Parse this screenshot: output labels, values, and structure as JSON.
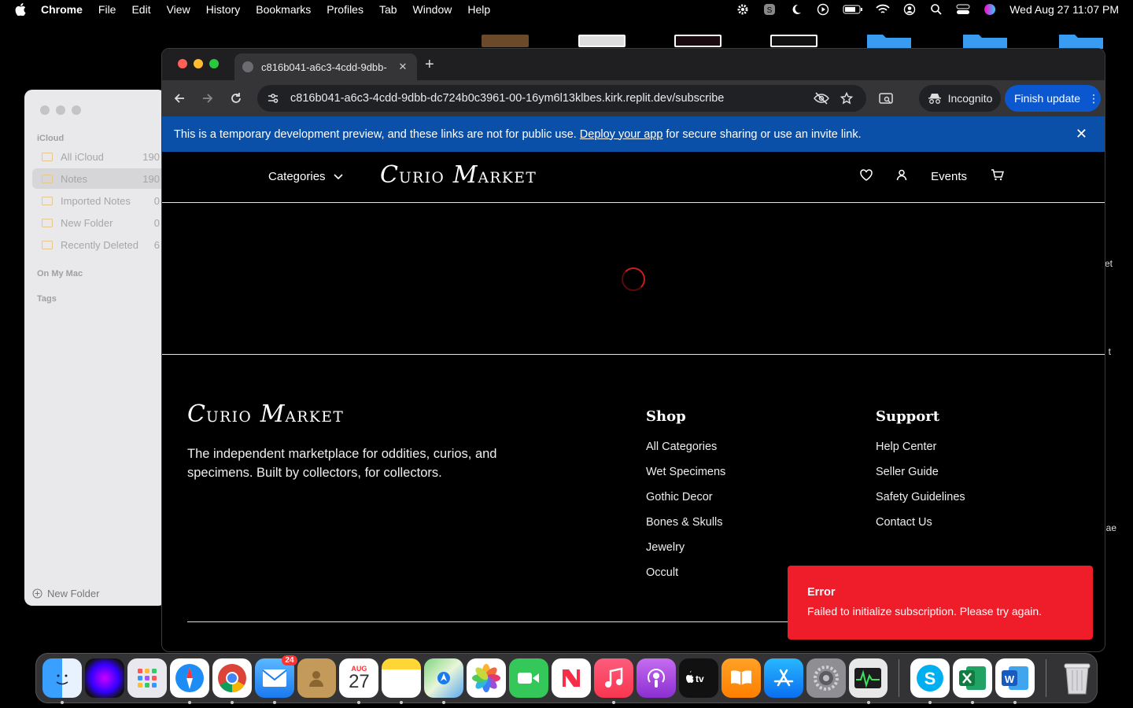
{
  "menubar": {
    "app_name": "Chrome",
    "items": [
      "File",
      "Edit",
      "View",
      "History",
      "Bookmarks",
      "Profiles",
      "Tab",
      "Window",
      "Help"
    ],
    "clock": "Wed Aug 27  11:07 PM"
  },
  "desktop_labels": [
    "et",
    "t",
    "ae"
  ],
  "notes": {
    "section_icloud": "iCloud",
    "folders": [
      {
        "label": "All iCloud",
        "count": "190"
      },
      {
        "label": "Notes",
        "count": "190"
      },
      {
        "label": "Imported Notes",
        "count": "0"
      },
      {
        "label": "New Folder",
        "count": "0"
      },
      {
        "label": "Recently Deleted",
        "count": "6"
      }
    ],
    "section_on_my_mac": "On My Mac",
    "section_tags": "Tags",
    "new_folder": "New Folder"
  },
  "chrome": {
    "tab_title": "c816b041-a6c3-4cdd-9dbb-",
    "url": "c816b041-a6c3-4cdd-9dbb-dc724b0c3961-00-16ym6l13klbes.kirk.replit.dev/subscribe",
    "incognito_label": "Incognito",
    "finish_update_label": "Finish update"
  },
  "banner": {
    "text_before": "This is a temporary development preview, and these links are not for public use.",
    "link_text": "Deploy your app",
    "text_after": "for secure sharing or use an invite link."
  },
  "site": {
    "categories_label": "Categories",
    "logo_c": "C",
    "logo_urio": "URIO",
    "logo_m": "M",
    "logo_arket": "ARKET",
    "events_label": "Events"
  },
  "footer": {
    "description": "The independent marketplace for oddities, curios, and specimens. Built by collectors, for collectors.",
    "shop_title": "Shop",
    "shop_links": [
      "All Categories",
      "Wet Specimens",
      "Gothic Decor",
      "Bones & Skulls",
      "Jewelry",
      "Occult"
    ],
    "support_title": "Support",
    "support_links": [
      "Help Center",
      "Seller Guide",
      "Safety Guidelines",
      "Contact Us"
    ]
  },
  "toast": {
    "title": "Error",
    "message": "Failed to initialize subscription. Please try again."
  },
  "dock": {
    "mail_badge": "24",
    "calendar_month": "AUG",
    "calendar_day": "27"
  }
}
